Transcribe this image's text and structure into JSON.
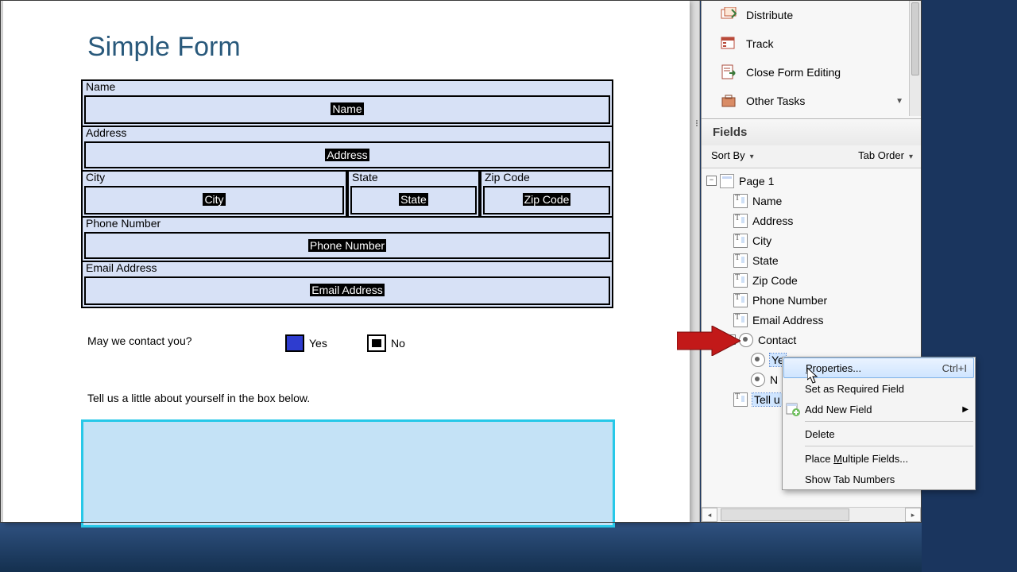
{
  "form": {
    "title": "Simple Form",
    "fields": {
      "name": {
        "label": "Name",
        "token": "Name"
      },
      "address": {
        "label": "Address",
        "token": "Address"
      },
      "city": {
        "label": "City",
        "token": "City"
      },
      "state": {
        "label": "State",
        "token": "State"
      },
      "zip": {
        "label": "Zip Code",
        "token": "Zip Code"
      },
      "phone": {
        "label": "Phone Number",
        "token": "Phone Number"
      },
      "email": {
        "label": "Email Address",
        "token": "Email Address"
      }
    },
    "contact_question": "May we contact you?",
    "yes": "Yes",
    "no": "No",
    "about": "Tell us a little about yourself in the box below."
  },
  "tasks": {
    "distribute": "Distribute",
    "track": "Track",
    "close": "Close Form Editing",
    "other": "Other Tasks"
  },
  "panel": {
    "header": "Fields",
    "sort": "Sort By",
    "tab": "Tab Order"
  },
  "tree": {
    "page": "Page 1",
    "name": "Name",
    "address": "Address",
    "city": "City",
    "state": "State",
    "zip": "Zip Code",
    "phone": "Phone Number",
    "email": "Email Address",
    "contact": "Contact",
    "yes": "Ye",
    "no": "N",
    "tell": "Tell u"
  },
  "ctx": {
    "properties": "roperties...",
    "properties_shortcut": "Ctrl+I",
    "required": "Set as Required Field",
    "addnew": "Add New Field",
    "delete": "Delete",
    "place": "ultiple Fields...",
    "show": "Show Tab Numbers"
  }
}
